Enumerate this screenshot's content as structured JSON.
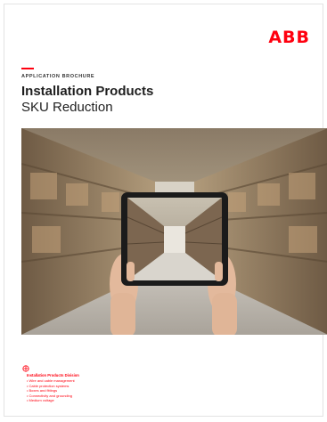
{
  "brand": {
    "logo_text": "ABB",
    "accent_color": "#ff000f"
  },
  "header": {
    "eyebrow": "APPLICATION BROCHURE",
    "title": "Installation Products",
    "subtitle": "SKU Reduction"
  },
  "hero": {
    "description_icon": "tablet-in-warehouse-photo"
  },
  "footer": {
    "division": "Installation Products Division",
    "items": [
      "Wire and cable management",
      "Cable protection systems",
      "Boxes and fittings",
      "Connectivity and grounding",
      "Medium voltage"
    ]
  }
}
